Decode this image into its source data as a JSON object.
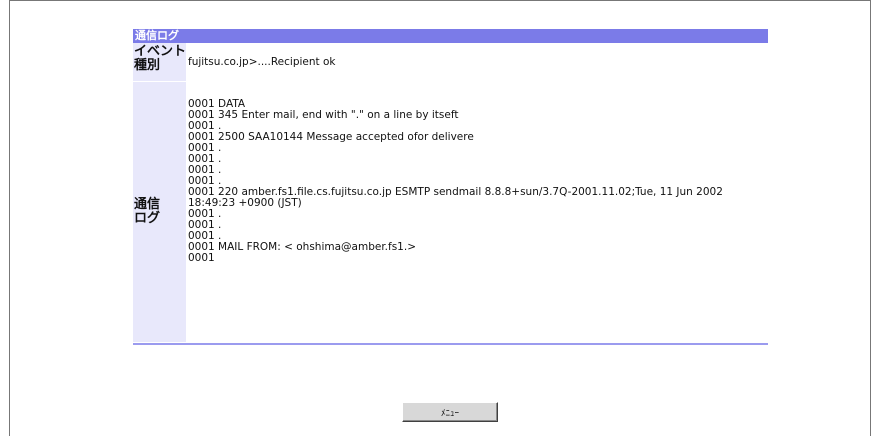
{
  "panel": {
    "title": "通信ログ",
    "event_label": "イベント\n種別",
    "event_value": "fujitsu.co.jp>....Recipient ok",
    "log_label": "通信\nログ",
    "log_lines": [
      "0001 DATA",
      "0001 345 Enter mail, end with \".\" on a line by itseft",
      "0001 .",
      "0001 2500 SAA10144 Message accepted ofor delivere",
      "0001 .",
      "0001 .",
      "0001 .",
      "0001 .",
      "0001 220 amber.fs1.file.cs.fujitsu.co.jp ESMTP sendmail 8.8.8+sun/3.7Q-2001.11.02;Tue, 11 Jun 2002 18:49:23 +0900 (JST)",
      "0001 .",
      "0001 .",
      "0001 .",
      "0001 MAIL FROM: < ohshima@amber.fs1.>",
      "0001"
    ]
  },
  "menu_button": "ﾒﾆｭｰ"
}
